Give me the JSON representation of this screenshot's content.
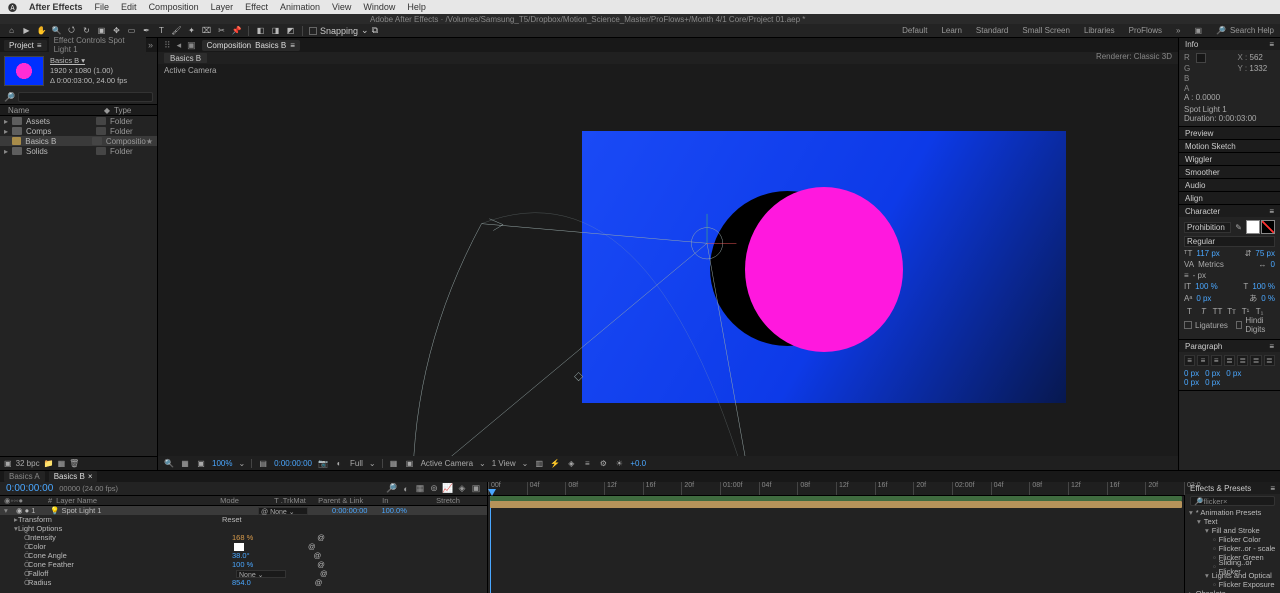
{
  "mac_menu": {
    "app": "After Effects",
    "items": [
      "File",
      "Edit",
      "Composition",
      "Layer",
      "Effect",
      "Animation",
      "View",
      "Window",
      "Help"
    ]
  },
  "titlebar": "Adobe After Effects · /Volumes/Samsung_T5/Dropbox/Motion_Science_Master/ProFlows+/Month 4/1 Core/Project 01.aep *",
  "toolbar": {
    "snapping": "Snapping",
    "workspaces": [
      "Default",
      "Learn",
      "Standard",
      "Small Screen",
      "Libraries",
      "ProFlows"
    ],
    "search_label": "Search Help"
  },
  "project": {
    "tab1": "Project",
    "tab2": "Effect Controls Spot Light 1",
    "thumb_name": "Basics B ▾",
    "thumb_info1": "1920 x 1080 (1.00)",
    "thumb_info2": "Δ 0:00:03:00, 24.00 fps",
    "col_name": "Name",
    "col_type": "Type",
    "items": [
      {
        "name": "Assets",
        "type": "Folder",
        "twirl": "▸",
        "star": ""
      },
      {
        "name": "Comps",
        "type": "Folder",
        "twirl": "▸",
        "star": ""
      },
      {
        "name": "Basics B",
        "type": "Compositio",
        "twirl": "",
        "sel": true,
        "star": "★"
      },
      {
        "name": "Solids",
        "type": "Folder",
        "twirl": "▸",
        "star": ""
      }
    ],
    "foot_bpc": "32 bpc"
  },
  "comp": {
    "crumb": "Composition",
    "crumb_name": "Basics B",
    "subtab": "Basics B",
    "renderer_label": "Renderer:",
    "renderer": "Classic 3D",
    "active_camera": "Active Camera",
    "footer": {
      "zoom": "100%",
      "time": "0:00:00:00",
      "res": "Full",
      "camera": "Active Camera",
      "views": "1 View",
      "extra": "+0.0"
    }
  },
  "right": {
    "info": {
      "title": "Info",
      "R": "R",
      "G": "G",
      "B": "B",
      "A": "A",
      "X": "X :",
      "Xv": "562",
      "Y": "Y :",
      "Yv": "1332",
      "Aval": "A : 0.0000",
      "sel": "Spot Light 1",
      "dur": "Duration: 0:00:03:00"
    },
    "preview": "Preview",
    "motion_sketch": "Motion Sketch",
    "wiggler": "Wiggler",
    "smoother": "Smoother",
    "audio": "Audio",
    "align": "Align",
    "character": {
      "title": "Character",
      "font": "Prohibition",
      "weight": "Regular",
      "size": "117 px",
      "leading": "75 px",
      "kerning": "Metrics",
      "tracking": "0",
      "vscale": "100 %",
      "hscale": "100 %",
      "baseline": "0 px",
      "tsume": "0 %",
      "px_label": "- px",
      "ligatures": "Ligatures",
      "hindi": "Hindi Digits"
    },
    "paragraph": {
      "title": "Paragraph",
      "vals": [
        "0 px",
        "0 px",
        "0 px",
        "0 px",
        "0 px",
        "0 px",
        "0 px"
      ]
    }
  },
  "timeline": {
    "tabs": [
      "Basics A",
      "Basics B"
    ],
    "timecode": "0:00:00:00",
    "sub": "00000 (24.00 fps)",
    "cols": {
      "num": "#",
      "layer": "Layer Name",
      "mode": "Mode",
      "trkmat": "T .TrkMat",
      "parent": "Parent & Link",
      "in": "In",
      "stretch": "Stretch"
    },
    "ruler": [
      "00f",
      "04f",
      "08f",
      "12f",
      "16f",
      "20f",
      "01:00f",
      "04f",
      "08f",
      "12f",
      "16f",
      "20f",
      "02:00f",
      "04f",
      "08f",
      "12f",
      "16f",
      "20f",
      "03:0"
    ],
    "layers": [
      {
        "tw": "▾",
        "sel": true,
        "num": "1",
        "name": "Spot Light 1",
        "mode": "",
        "parent": "None",
        "in": "0:00:00:00",
        "stretch": "100.0%"
      },
      {
        "tw": "",
        "ind": 1,
        "name": "Transform",
        "extra": "Reset"
      },
      {
        "tw": "▾",
        "ind": 1,
        "name": "Light Options"
      },
      {
        "tw": "",
        "ind": 2,
        "dot": true,
        "name": "Intensity",
        "val": "168 %",
        "orange": true
      },
      {
        "tw": "",
        "ind": 2,
        "dot": true,
        "name": "Color",
        "swatch": true
      },
      {
        "tw": "",
        "ind": 2,
        "dot": true,
        "name": "Cone Angle",
        "val": "38.0°"
      },
      {
        "tw": "",
        "ind": 2,
        "dot": true,
        "name": "Cone Feather",
        "val": "100 %"
      },
      {
        "tw": "",
        "ind": 2,
        "dot": true,
        "name": "Falloff",
        "ddl": "None"
      },
      {
        "tw": "",
        "ind": 2,
        "dot": true,
        "name": "Radius",
        "val": "854.0"
      }
    ]
  },
  "effects": {
    "title": "Effects & Presets",
    "search": "flicker",
    "tree": [
      {
        "l": 0,
        "tw": "▾",
        "name": "* Animation Presets"
      },
      {
        "l": 1,
        "tw": "▾",
        "name": "Text"
      },
      {
        "l": 2,
        "tw": "▾",
        "name": "Fill and Stroke"
      },
      {
        "l": 3,
        "name": "Flicker Color"
      },
      {
        "l": 3,
        "name": "Flicker..or - scale"
      },
      {
        "l": 3,
        "name": "Flicker Green"
      },
      {
        "l": 3,
        "name": "Sliding..or Flicker"
      },
      {
        "l": 2,
        "tw": "▾",
        "name": "Lights and Optical"
      },
      {
        "l": 3,
        "name": "Flicker Exposure"
      },
      {
        "l": 0,
        "tw": "▸",
        "name": "Obsolete"
      }
    ]
  }
}
